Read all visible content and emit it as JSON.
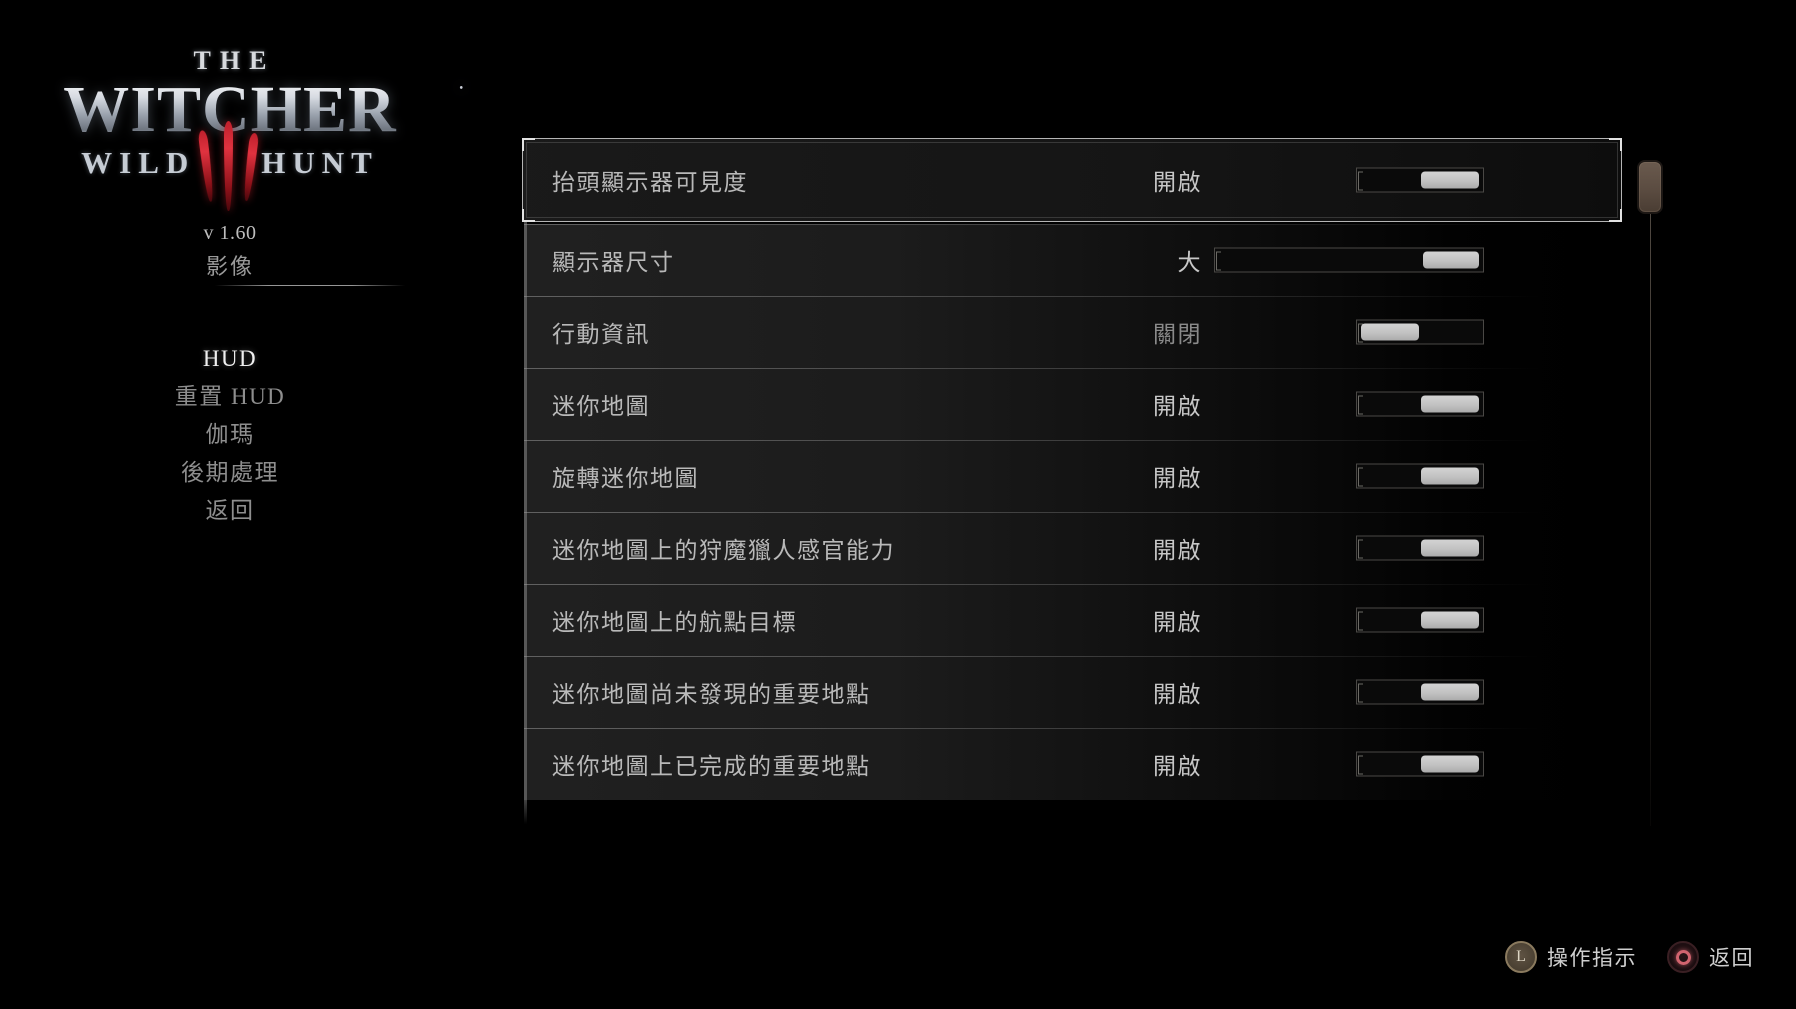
{
  "game": {
    "logo_the": "THE",
    "logo_main": "WITCHER",
    "logo_wild": "WILD",
    "logo_hunt": "HUNT",
    "version": "v 1.60"
  },
  "sidebar": {
    "section_title": "影像",
    "items": [
      {
        "label": "HUD",
        "active": true
      },
      {
        "label": "重置 HUD",
        "active": false
      },
      {
        "label": "伽瑪",
        "active": false
      },
      {
        "label": "後期處理",
        "active": false
      },
      {
        "label": "返回",
        "active": false
      }
    ]
  },
  "settings": {
    "rows": [
      {
        "label": "抬頭顯示器可見度",
        "value": "開啟",
        "control": "toggle",
        "state": "on",
        "selected": true
      },
      {
        "label": "顯示器尺寸",
        "value": "大",
        "control": "slider",
        "state": "max",
        "selected": false
      },
      {
        "label": "行動資訊",
        "value": "關閉",
        "control": "toggle",
        "state": "off",
        "selected": false
      },
      {
        "label": "迷你地圖",
        "value": "開啟",
        "control": "toggle",
        "state": "on",
        "selected": false
      },
      {
        "label": "旋轉迷你地圖",
        "value": "開啟",
        "control": "toggle",
        "state": "on",
        "selected": false
      },
      {
        "label": "迷你地圖上的狩魔獵人感官能力",
        "value": "開啟",
        "control": "toggle",
        "state": "on",
        "selected": false
      },
      {
        "label": "迷你地圖上的航點目標",
        "value": "開啟",
        "control": "toggle",
        "state": "on",
        "selected": false
      },
      {
        "label": "迷你地圖尚未發現的重要地點",
        "value": "開啟",
        "control": "toggle",
        "state": "on",
        "selected": false
      },
      {
        "label": "迷你地圖上已完成的重要地點",
        "value": "開啟",
        "control": "toggle",
        "state": "on",
        "selected": false
      }
    ]
  },
  "scrollbar": {
    "position_percent": 0
  },
  "actions": [
    {
      "glyph": "L",
      "icon": "l-button-icon",
      "label": "操作指示"
    },
    {
      "glyph": "",
      "icon": "circle-button-icon",
      "label": "返回"
    }
  ],
  "colors": {
    "accent_red": "#d1646f",
    "logo_red": "#c0202c",
    "scroll_thumb": "#5b4c41",
    "text_primary": "#c7c7c7",
    "text_dim": "#8a8a8a"
  }
}
